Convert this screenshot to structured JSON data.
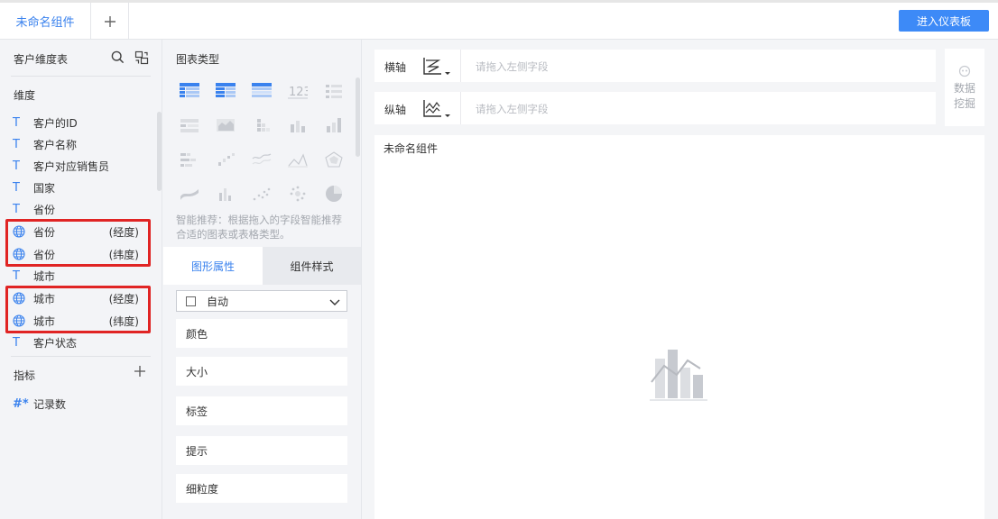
{
  "topbar": {
    "tab_label": "未命名组件",
    "add_tab_icon": "plus-icon",
    "enter_dashboard_label": "进入仪表板",
    "accent_color": "#3d8af7"
  },
  "left_panel": {
    "table_name": "客户维度表",
    "dimension_section": "维度",
    "dimensions": [
      {
        "type": "T",
        "name": "客户的ID"
      },
      {
        "type": "T",
        "name": "客户名称"
      },
      {
        "type": "T",
        "name": "客户对应销售员"
      },
      {
        "type": "T",
        "name": "国家"
      },
      {
        "type": "T",
        "name": "省份"
      },
      {
        "type": "geo",
        "name": "省份",
        "sub": "(经度)"
      },
      {
        "type": "geo",
        "name": "省份",
        "sub": "(纬度)"
      },
      {
        "type": "T",
        "name": "城市"
      },
      {
        "type": "geo",
        "name": "城市",
        "sub": "(经度)"
      },
      {
        "type": "geo",
        "name": "城市",
        "sub": "(纬度)"
      },
      {
        "type": "T",
        "name": "客户状态"
      }
    ],
    "metric_section": "指标",
    "metrics": [
      {
        "type": "#",
        "name": "记录数"
      }
    ],
    "highlight_color": "#e02424"
  },
  "middle_panel": {
    "chart_type_title": "图表类型",
    "smart_tip": "智能推荐：根据拖入的字段智能推荐合适的图表或表格类型。",
    "tabs": [
      "图形属性",
      "组件样式"
    ],
    "shape_select": "自动",
    "properties": [
      "颜色",
      "大小",
      "标签",
      "提示",
      "细粒度"
    ]
  },
  "axes": {
    "x_label": "横轴",
    "y_label": "纵轴",
    "placeholder": "请拖入左侧字段"
  },
  "mining": {
    "label": "数据挖掘"
  },
  "canvas": {
    "title": "未命名组件"
  }
}
